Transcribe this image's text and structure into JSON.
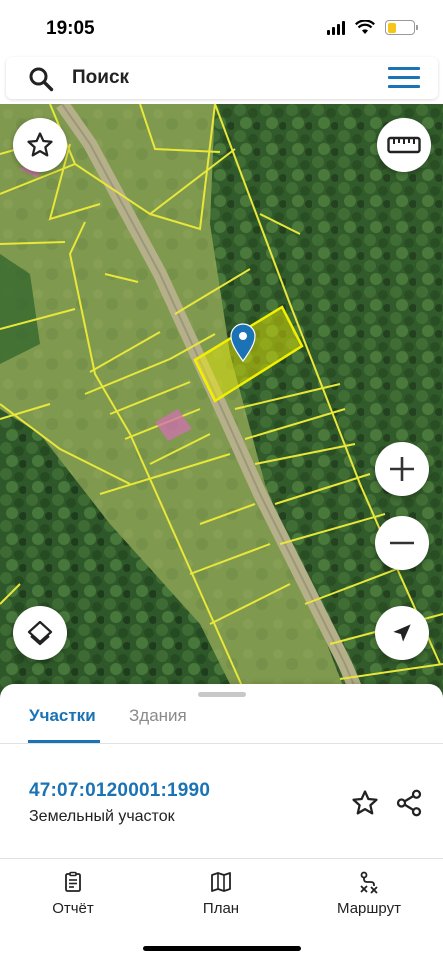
{
  "status_bar": {
    "time": "19:05",
    "battery_level": 0.35,
    "battery_color": "#f5c518"
  },
  "search": {
    "placeholder": "Поиск",
    "icon": "search-icon",
    "menu_icon": "hamburger-menu-icon",
    "accent": "#1a73b5"
  },
  "map": {
    "type": "satellite",
    "parcel_outline_color": "#e8e73a",
    "selected_parcel_fill": "#f2f000",
    "building_fill": "#d070b0",
    "marker_color": "#1a73b5",
    "controls": {
      "favorite": "star-icon",
      "ruler": "ruler-icon",
      "zoom_in": "plus-icon",
      "zoom_out": "minus-icon",
      "layers": "layers-icon",
      "locate": "navigation-arrow-icon"
    }
  },
  "sheet": {
    "tabs": [
      {
        "label": "Участки",
        "active": true
      },
      {
        "label": "Здания",
        "active": false
      }
    ],
    "parcel": {
      "number": "47:07:0120001:1990",
      "type": "Земельный участок"
    }
  },
  "bottom_nav": [
    {
      "label": "Отчёт",
      "icon": "report-icon"
    },
    {
      "label": "План",
      "icon": "map-plan-icon"
    },
    {
      "label": "Маршрут",
      "icon": "route-icon"
    }
  ]
}
